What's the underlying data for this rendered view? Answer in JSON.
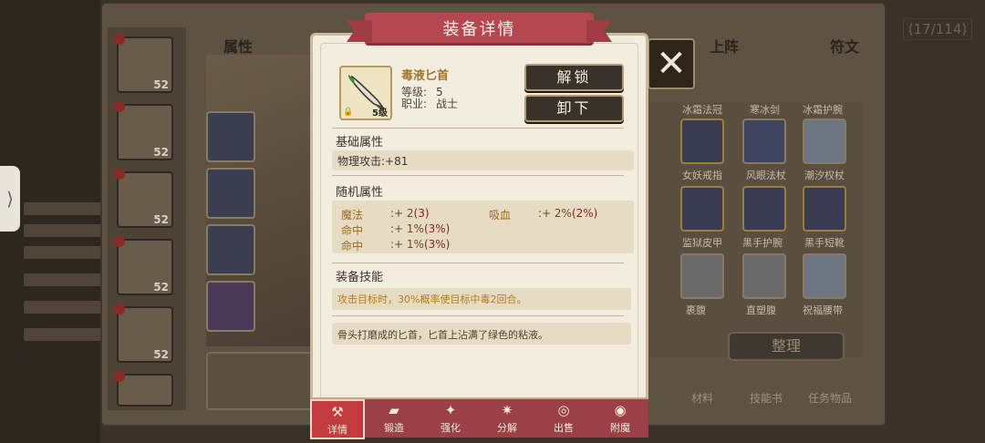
{
  "modal": {
    "title": "装备详情",
    "item": {
      "name": "毒液匕首",
      "level_label": "等级:",
      "level_value": "5",
      "job_label": "职业:",
      "job_value": "战士",
      "icon_level": "5级"
    },
    "buttons": {
      "unlock": "解锁",
      "unequip": "卸下"
    },
    "basic": {
      "title": "基础属性",
      "stat": "物理攻击:+81"
    },
    "random": {
      "title": "随机属性",
      "lines": [
        {
          "name": "魔法",
          "value": ":+ 2",
          "extra": "(3)"
        },
        {
          "name": "吸血",
          "value": ":+ 2%",
          "extra": "(2%)"
        },
        {
          "name": "命中",
          "value": ":+ 1%",
          "extra": "(3%)"
        },
        {
          "name": "命中",
          "value": ":+ 1%",
          "extra": "(3%)"
        }
      ]
    },
    "skill": {
      "title": "装备技能",
      "text": "攻击目标时，30%概率使目标中毒2回合。"
    },
    "description": "骨头打磨成的匕首，匕首上沾满了绿色的粘液。",
    "tabs": [
      {
        "label": "详情",
        "icon": "hammer-icon",
        "active": true
      },
      {
        "label": "锻造",
        "icon": "anvil-icon",
        "active": false
      },
      {
        "label": "强化",
        "icon": "sparkle-icon",
        "active": false
      },
      {
        "label": "分解",
        "icon": "burst-icon",
        "active": false
      },
      {
        "label": "出售",
        "icon": "coins-icon",
        "active": false
      },
      {
        "label": "附魔",
        "icon": "eye-icon",
        "active": false
      }
    ]
  },
  "background": {
    "tabs": [
      "属性",
      "上阵",
      "符文"
    ],
    "count": "(17/114)",
    "hero_levels": [
      "52",
      "52",
      "52",
      "52",
      "52"
    ],
    "equipment_labels": [
      "冰霜法冠",
      "寒冰剑",
      "冰霜护腕",
      "女妖戒指",
      "风眼法杖",
      "潮汐权杖",
      "监狱皮甲",
      "黑手护腕",
      "黑手短靴",
      "裹腹",
      "直塑腹",
      "祝福腰带"
    ],
    "sort_button": "整理",
    "bottom_categories": [
      "材料",
      "技能书",
      "任务物品"
    ],
    "colors": {
      "accent_red": "#b4474f",
      "gold_text": "#a0782d",
      "panel_bg": "#f3ede0"
    }
  }
}
